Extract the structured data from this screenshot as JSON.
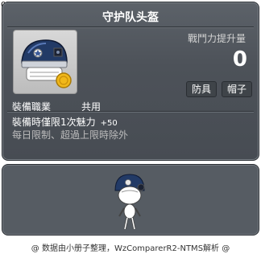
{
  "item_id": "01006456",
  "title": "守护队头盔",
  "power": {
    "label": "戰鬥力提升量",
    "value": "0"
  },
  "tags": [
    "防具",
    "帽子"
  ],
  "job": {
    "label": "裝備職業",
    "value": "共用"
  },
  "stat": {
    "text": "裝備時僅限1次魅力",
    "bonus": "+50"
  },
  "limit_text": "每日限制、超過上限時除外",
  "footer": "@ 数据由小册子整理，WzComparerR2-NTMS解析 @",
  "colors": {
    "panel": "#4d5259",
    "preview_panel": "#565c63",
    "text": "#ffffff",
    "muted": "#bcbcbc"
  }
}
